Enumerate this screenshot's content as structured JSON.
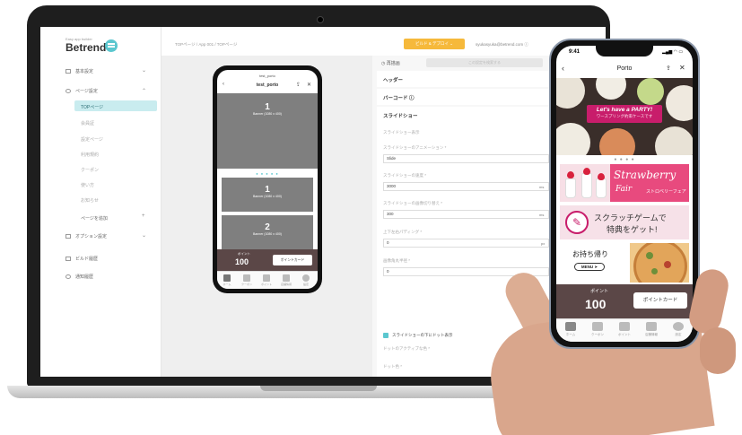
{
  "laptop": {
    "sidebar": {
      "logo_small": "Easy app builder",
      "logo": "Betrend",
      "items": [
        {
          "label": "基本設定",
          "chevron": "⌄"
        },
        {
          "label": "ページ設定",
          "chevron": "⌃"
        },
        {
          "label": "オプション設定",
          "chevron": "⌄"
        },
        {
          "label": "ビルド履歴"
        },
        {
          "label": "通知履歴"
        }
      ],
      "sub_items": [
        "TOPページ",
        "会員証",
        "設定ページ",
        "利用規約",
        "クーポン",
        "使い方",
        "お知らせ"
      ],
      "add_page": "ページを追加",
      "add_icon": "+"
    },
    "breadcrumb": "TOPページ / App 001 / TOPページ",
    "deploy_button": "ビルド & デプロイ ⌄",
    "account": "syukasyuka@betrend.com ⓘ",
    "form": {
      "top_label": "◷ 再描画",
      "search_placeholder": "この設定を検索する",
      "header": "ヘッダー",
      "barcode": "バーコード ⓘ",
      "slideshow": "スライドショー",
      "labels": [
        "スライドショー表示",
        "スライドショーのアニメーション *",
        "スライドショーの速度 *",
        "スライドショーの画像切り替え *",
        "上下左右パディング *",
        "画像角丸半径 *"
      ],
      "values": [
        "Slide",
        "3000",
        "300",
        "0",
        "0"
      ],
      "units": [
        "ms",
        "ms",
        "px"
      ],
      "checkbox_label": "スライドショーの下にドット表示",
      "dot_label": "ドットのアクティブな色 *",
      "dot_label2": "ドット色 *"
    },
    "mini_phone": {
      "status": "test_porto",
      "title": "test_porto",
      "back_icon": "‹",
      "share_icon": "⇪",
      "close_icon": "✕",
      "banners": [
        {
          "num": "1",
          "text": "Banner (1080 x 400)"
        },
        {
          "num": "1",
          "text": "Banner (1080 x 400)"
        },
        {
          "num": "2",
          "text": "Banner (1080 x 400)"
        },
        {
          "num": "2",
          "text": "Banner (1080 x 400)"
        }
      ],
      "dots": "● ● ● ● ●",
      "point_label": "ポイント",
      "point_value": "100",
      "card_button": "ポイントカード",
      "tabs": [
        "ホーム",
        "クーポン",
        "ポイント",
        "店舗情報",
        "設定"
      ]
    }
  },
  "phone": {
    "time": "9:41",
    "status_icons": "▂▄▆ ◠ ▭",
    "title": "Porto",
    "back_icon": "‹",
    "share_icon": "⇪",
    "close_icon": "✕",
    "party_main": "Let's have a PARTY!",
    "party_sub": "ワースプリング約束ケースです",
    "dots": "● ● ● ●",
    "strawberry_1": "Strawberry",
    "strawberry_2": "Fair",
    "strawberry_3": "ストロベリーフェア",
    "scratch_line1": "スクラッチゲームで",
    "scratch_line2": "特典をゲット!",
    "scratch_icon": "✎",
    "takeout_title": "お持ち帰り",
    "takeout_menu": "MENU ➤",
    "point_label": "ポイント",
    "point_value": "100",
    "card_button": "ポイントカード",
    "tabs": [
      "ホーム",
      "クーポン",
      "ポイント",
      "店舗情報",
      "設定"
    ]
  },
  "colors": {
    "accent": "#5bc7cf",
    "deploy": "#f6b93b",
    "point_bar": "#5b4747",
    "strawberry": "#e84a7e",
    "party": "#c81d6b"
  }
}
